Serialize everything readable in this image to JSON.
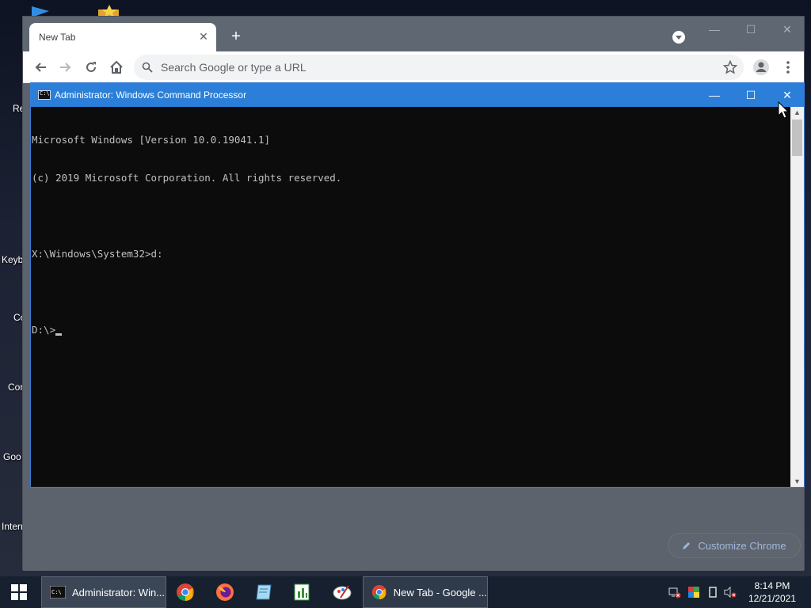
{
  "desktop": {
    "icon_labels": [
      "Re",
      "Keyb",
      "Co",
      "Cor",
      "Goo",
      "Intern"
    ]
  },
  "chrome": {
    "tab_title": "New Tab",
    "omnibox_placeholder": "Search Google or type a URL",
    "customize_label": "Customize Chrome"
  },
  "cmd": {
    "title": "Administrator: Windows Command Processor",
    "icon_text": "C:\\",
    "lines": [
      "Microsoft Windows [Version 10.0.19041.1]",
      "(c) 2019 Microsoft Corporation. All rights reserved.",
      "",
      "X:\\Windows\\System32>d:",
      "",
      "D:\\>"
    ]
  },
  "taskbar": {
    "items": [
      {
        "label": "Administrator: Win...",
        "icon": "cmd-icon",
        "active": true
      },
      {
        "label": "",
        "icon": "chrome-icon"
      },
      {
        "label": "",
        "icon": "firefox-icon"
      },
      {
        "label": "",
        "icon": "notepad-icon"
      },
      {
        "label": "",
        "icon": "spreadsheet-icon"
      },
      {
        "label": "",
        "icon": "paint-icon"
      },
      {
        "label": "New Tab - Google ...",
        "icon": "chrome-icon",
        "active": false
      }
    ],
    "time": "8:14 PM",
    "date": "12/21/2021"
  },
  "colors": {
    "cmd_titlebar": "#2b7fd8",
    "taskbar": "#16202e",
    "customize_text": "#9fb7da"
  }
}
